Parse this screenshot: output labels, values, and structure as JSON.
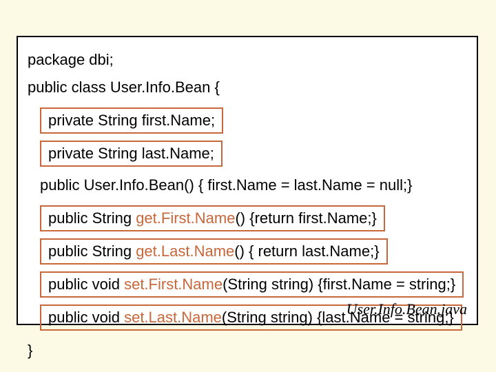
{
  "code": {
    "package_line": "package dbi;",
    "class_line": "public class User.Info.Bean {",
    "field_first": "private String first.Name;",
    "field_last": "private String last.Name;",
    "ctor_line": "public User.Info.Bean() {  first.Name = last.Name = null;}",
    "get_first_pre": "public String ",
    "get_first_accent": "get.First.Name",
    "get_first_post": "() {return first.Name;}",
    "get_last_pre": "public String ",
    "get_last_accent": "get.Last.Name",
    "get_last_post": "() {   return last.Name;}",
    "set_first_pre": "public void ",
    "set_first_accent": "set.First.Name",
    "set_first_post": "(String string) {first.Name = string;}",
    "set_last_pre": "public void ",
    "set_last_accent": "set.Last.Name",
    "set_last_post": "(String string) {last.Name = string;}",
    "close_brace": "}"
  },
  "filename": "User.Info.Bean.java"
}
